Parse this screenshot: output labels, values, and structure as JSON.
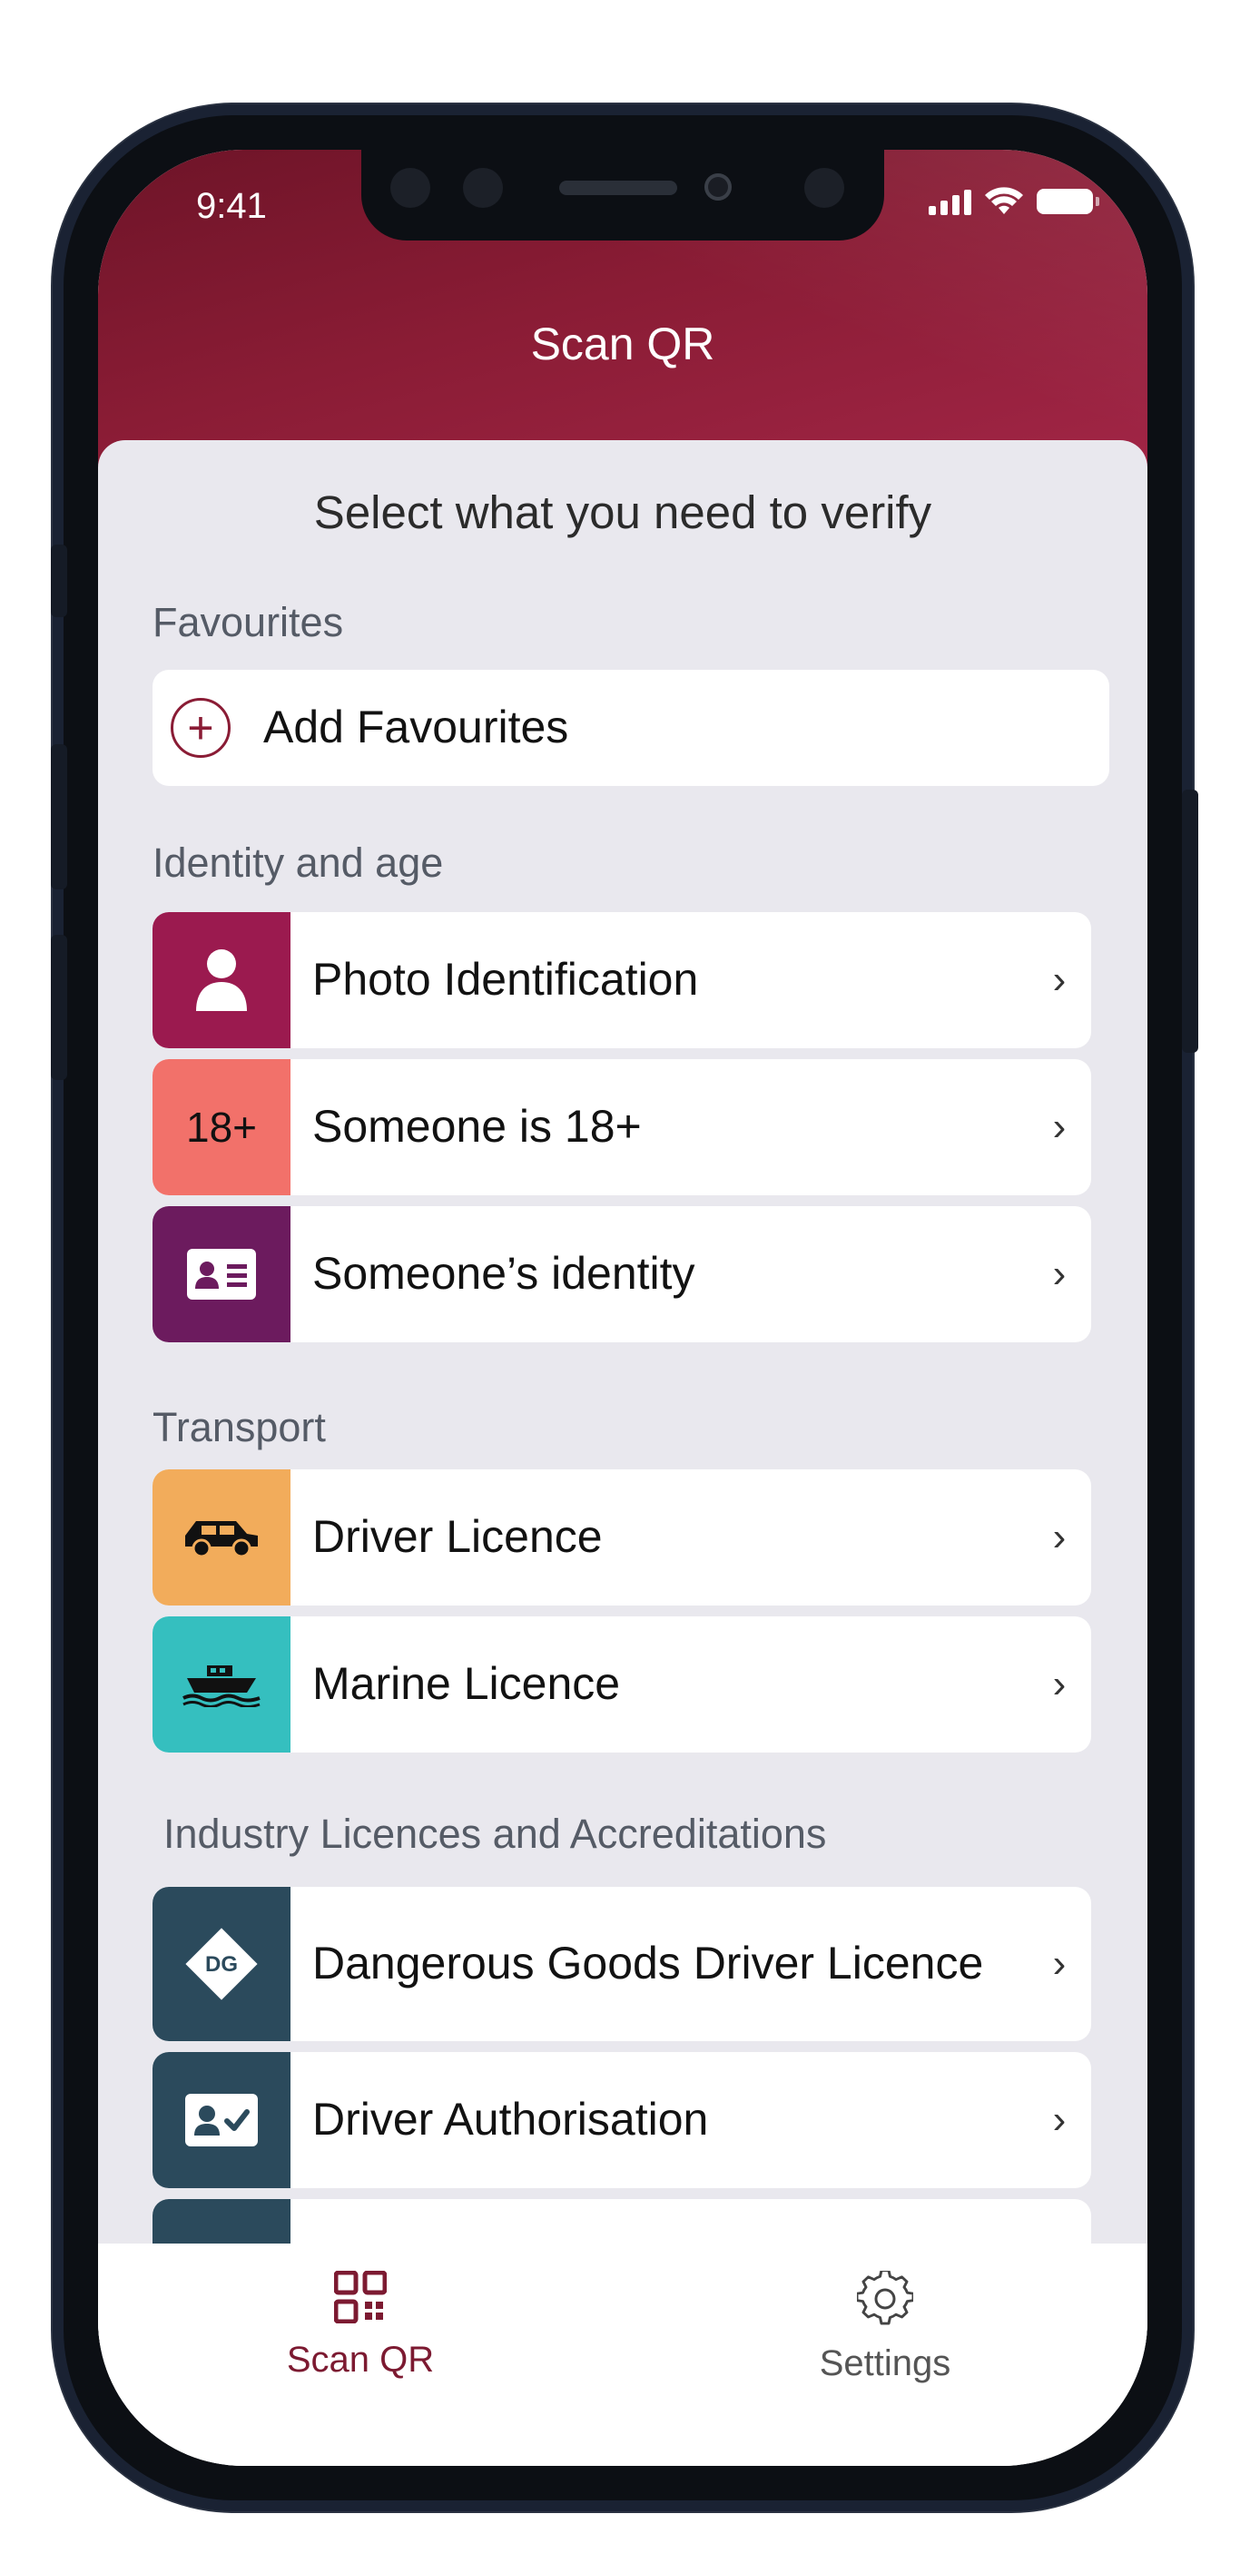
{
  "status_bar": {
    "time": "9:41"
  },
  "header": {
    "title": "Scan QR"
  },
  "main": {
    "subtitle": "Select what you need to verify",
    "favourites": {
      "section_label": "Favourites",
      "add_label": "Add Favourites"
    },
    "identity": {
      "section_label": "Identity and age",
      "items": [
        {
          "label": "Photo Identification",
          "icon": "person-icon",
          "color": "#9b1a4f"
        },
        {
          "label": "Someone is 18+",
          "icon_text": "18+",
          "color": "#f2716a"
        },
        {
          "label": "Someone’s identity",
          "icon": "id-card-icon",
          "color": "#6c1b5e"
        }
      ]
    },
    "transport": {
      "section_label": "Transport",
      "items": [
        {
          "label": "Driver Licence",
          "icon": "car-icon",
          "color": "#f2ac5b"
        },
        {
          "label": "Marine Licence",
          "icon": "boat-icon",
          "color": "#35bfbf"
        }
      ]
    },
    "industry": {
      "section_label": "Industry Licences and Accreditations",
      "items": [
        {
          "label": "Dangerous Goods Driver Licence",
          "icon": "dg-diamond-icon",
          "icon_text": "DG",
          "color": "#2b4a5c"
        },
        {
          "label": "Driver Authorisation",
          "icon": "id-check-icon",
          "color": "#2b4a5c"
        }
      ]
    },
    "chevron": "›"
  },
  "tabbar": {
    "tabs": [
      {
        "label": "Scan QR",
        "icon": "qr-icon",
        "active": true
      },
      {
        "label": "Settings",
        "icon": "gear-icon",
        "active": false
      }
    ]
  },
  "colors": {
    "brand": "#8a1c35",
    "background": "#e9e8ee"
  }
}
